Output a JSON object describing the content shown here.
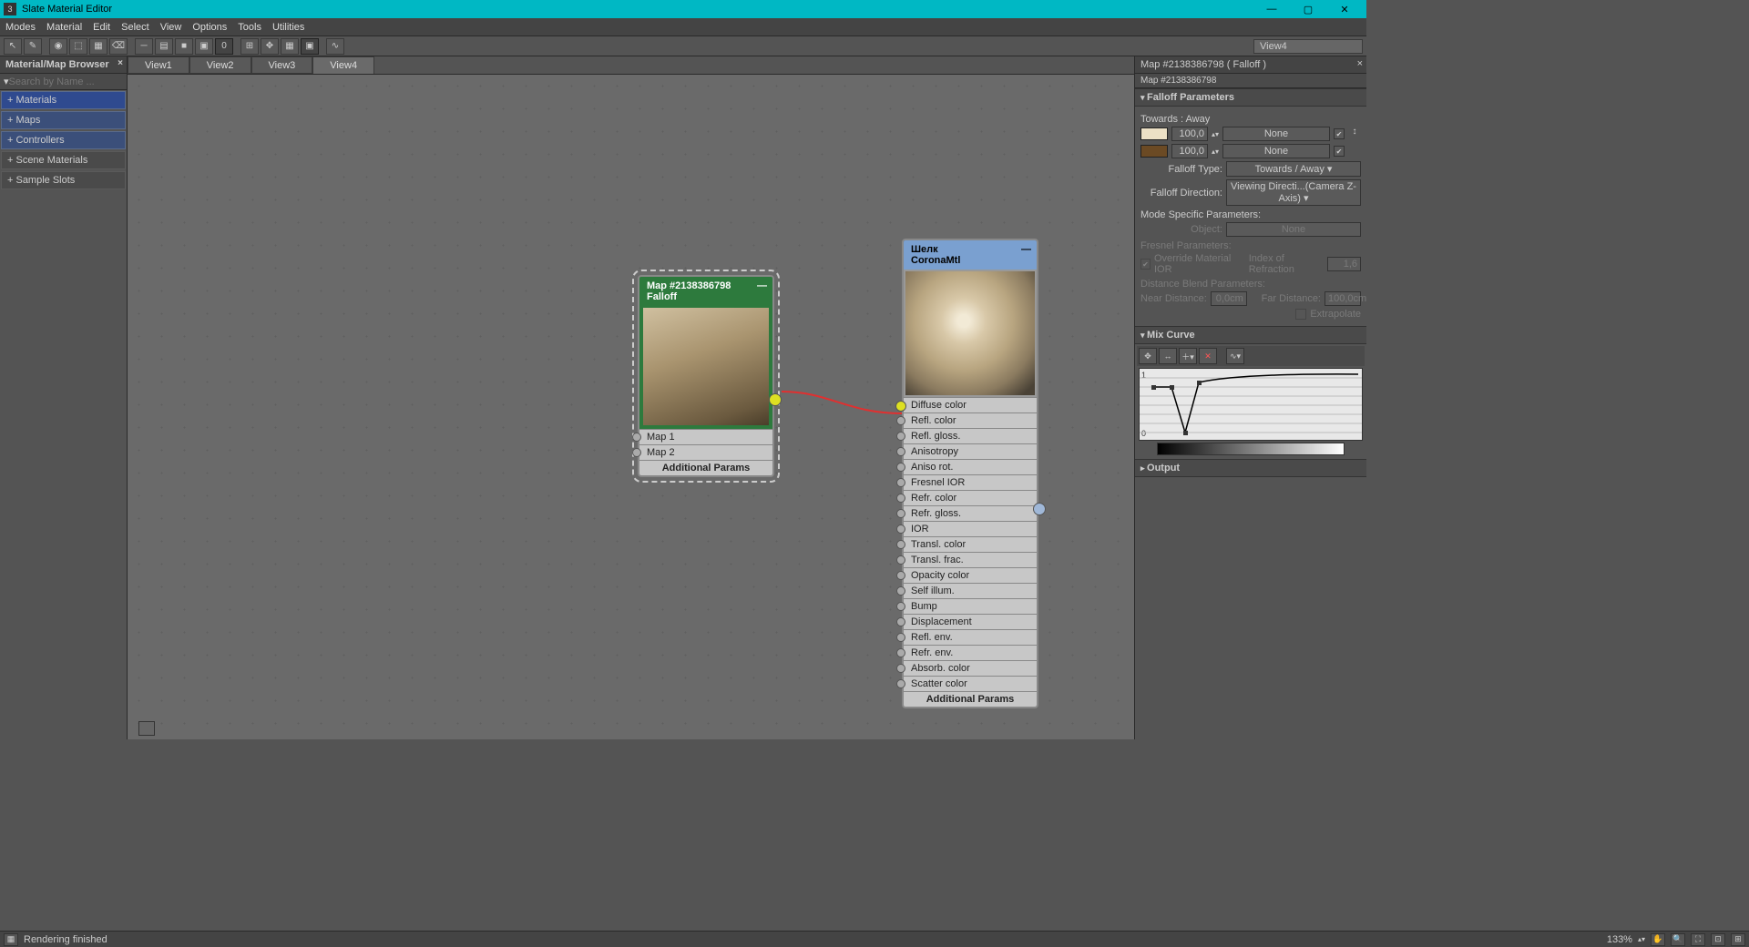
{
  "titlebar": {
    "appicon": "3",
    "title": "Slate Material Editor"
  },
  "menubar": [
    "Modes",
    "Material",
    "Edit",
    "Select",
    "View",
    "Options",
    "Tools",
    "Utilities"
  ],
  "viewdropdown": "View4",
  "leftpanel": {
    "title": "Material/Map Browser",
    "searchPlaceholder": "Search by Name ...",
    "cats": [
      "+ Materials",
      "+ Maps",
      "+ Controllers",
      "+ Scene Materials",
      "+ Sample Slots"
    ]
  },
  "tabs": [
    "View1",
    "View2",
    "View3",
    "View4"
  ],
  "falloffNode": {
    "title": "Map #2138386798",
    "type": "Falloff",
    "rows": [
      "Map 1",
      "Map 2"
    ],
    "additional": "Additional Params"
  },
  "coronaNode": {
    "title": "Шелк",
    "type": "CoronaMtl",
    "rows": [
      "Diffuse color",
      "Refl. color",
      "Refl. gloss.",
      "Anisotropy",
      "Aniso rot.",
      "Fresnel IOR",
      "Refr. color",
      "Refr. gloss.",
      "IOR",
      "Transl. color",
      "Transl. frac.",
      "Opacity color",
      "Self illum.",
      "Bump",
      "Displacement",
      "Refl. env.",
      "Refr. env.",
      "Absorb. color",
      "Scatter color"
    ],
    "additional": "Additional Params"
  },
  "rightpanel": {
    "title": "Map #2138386798  ( Falloff )",
    "sub": "Map #2138386798",
    "roll1": "Falloff Parameters",
    "towardsAway": "Towards : Away",
    "val1": "100,0",
    "none": "None",
    "val2": "100,0",
    "falloffTypeLbl": "Falloff Type:",
    "falloffType": "Towards / Away",
    "falloffDirLbl": "Falloff Direction:",
    "falloffDir": "Viewing Directi...(Camera Z-Axis)",
    "modeSpec": "Mode Specific Parameters:",
    "objectLbl": "Object:",
    "fresnel": "Fresnel Parameters:",
    "override": "Override Material IOR",
    "iorLbl": "Index of Refraction",
    "iorVal": "1,6",
    "distBlend": "Distance Blend Parameters:",
    "nearLbl": "Near Distance:",
    "nearVal": "0,0cm",
    "farLbl": "Far Distance:",
    "farVal": "100,0cm",
    "extrapolate": "Extrapolate",
    "roll2": "Mix Curve",
    "roll3": "Output",
    "curveY1": "1",
    "curveY0": "0"
  },
  "statusbar": {
    "text": "Rendering finished",
    "zoom": "133%"
  }
}
